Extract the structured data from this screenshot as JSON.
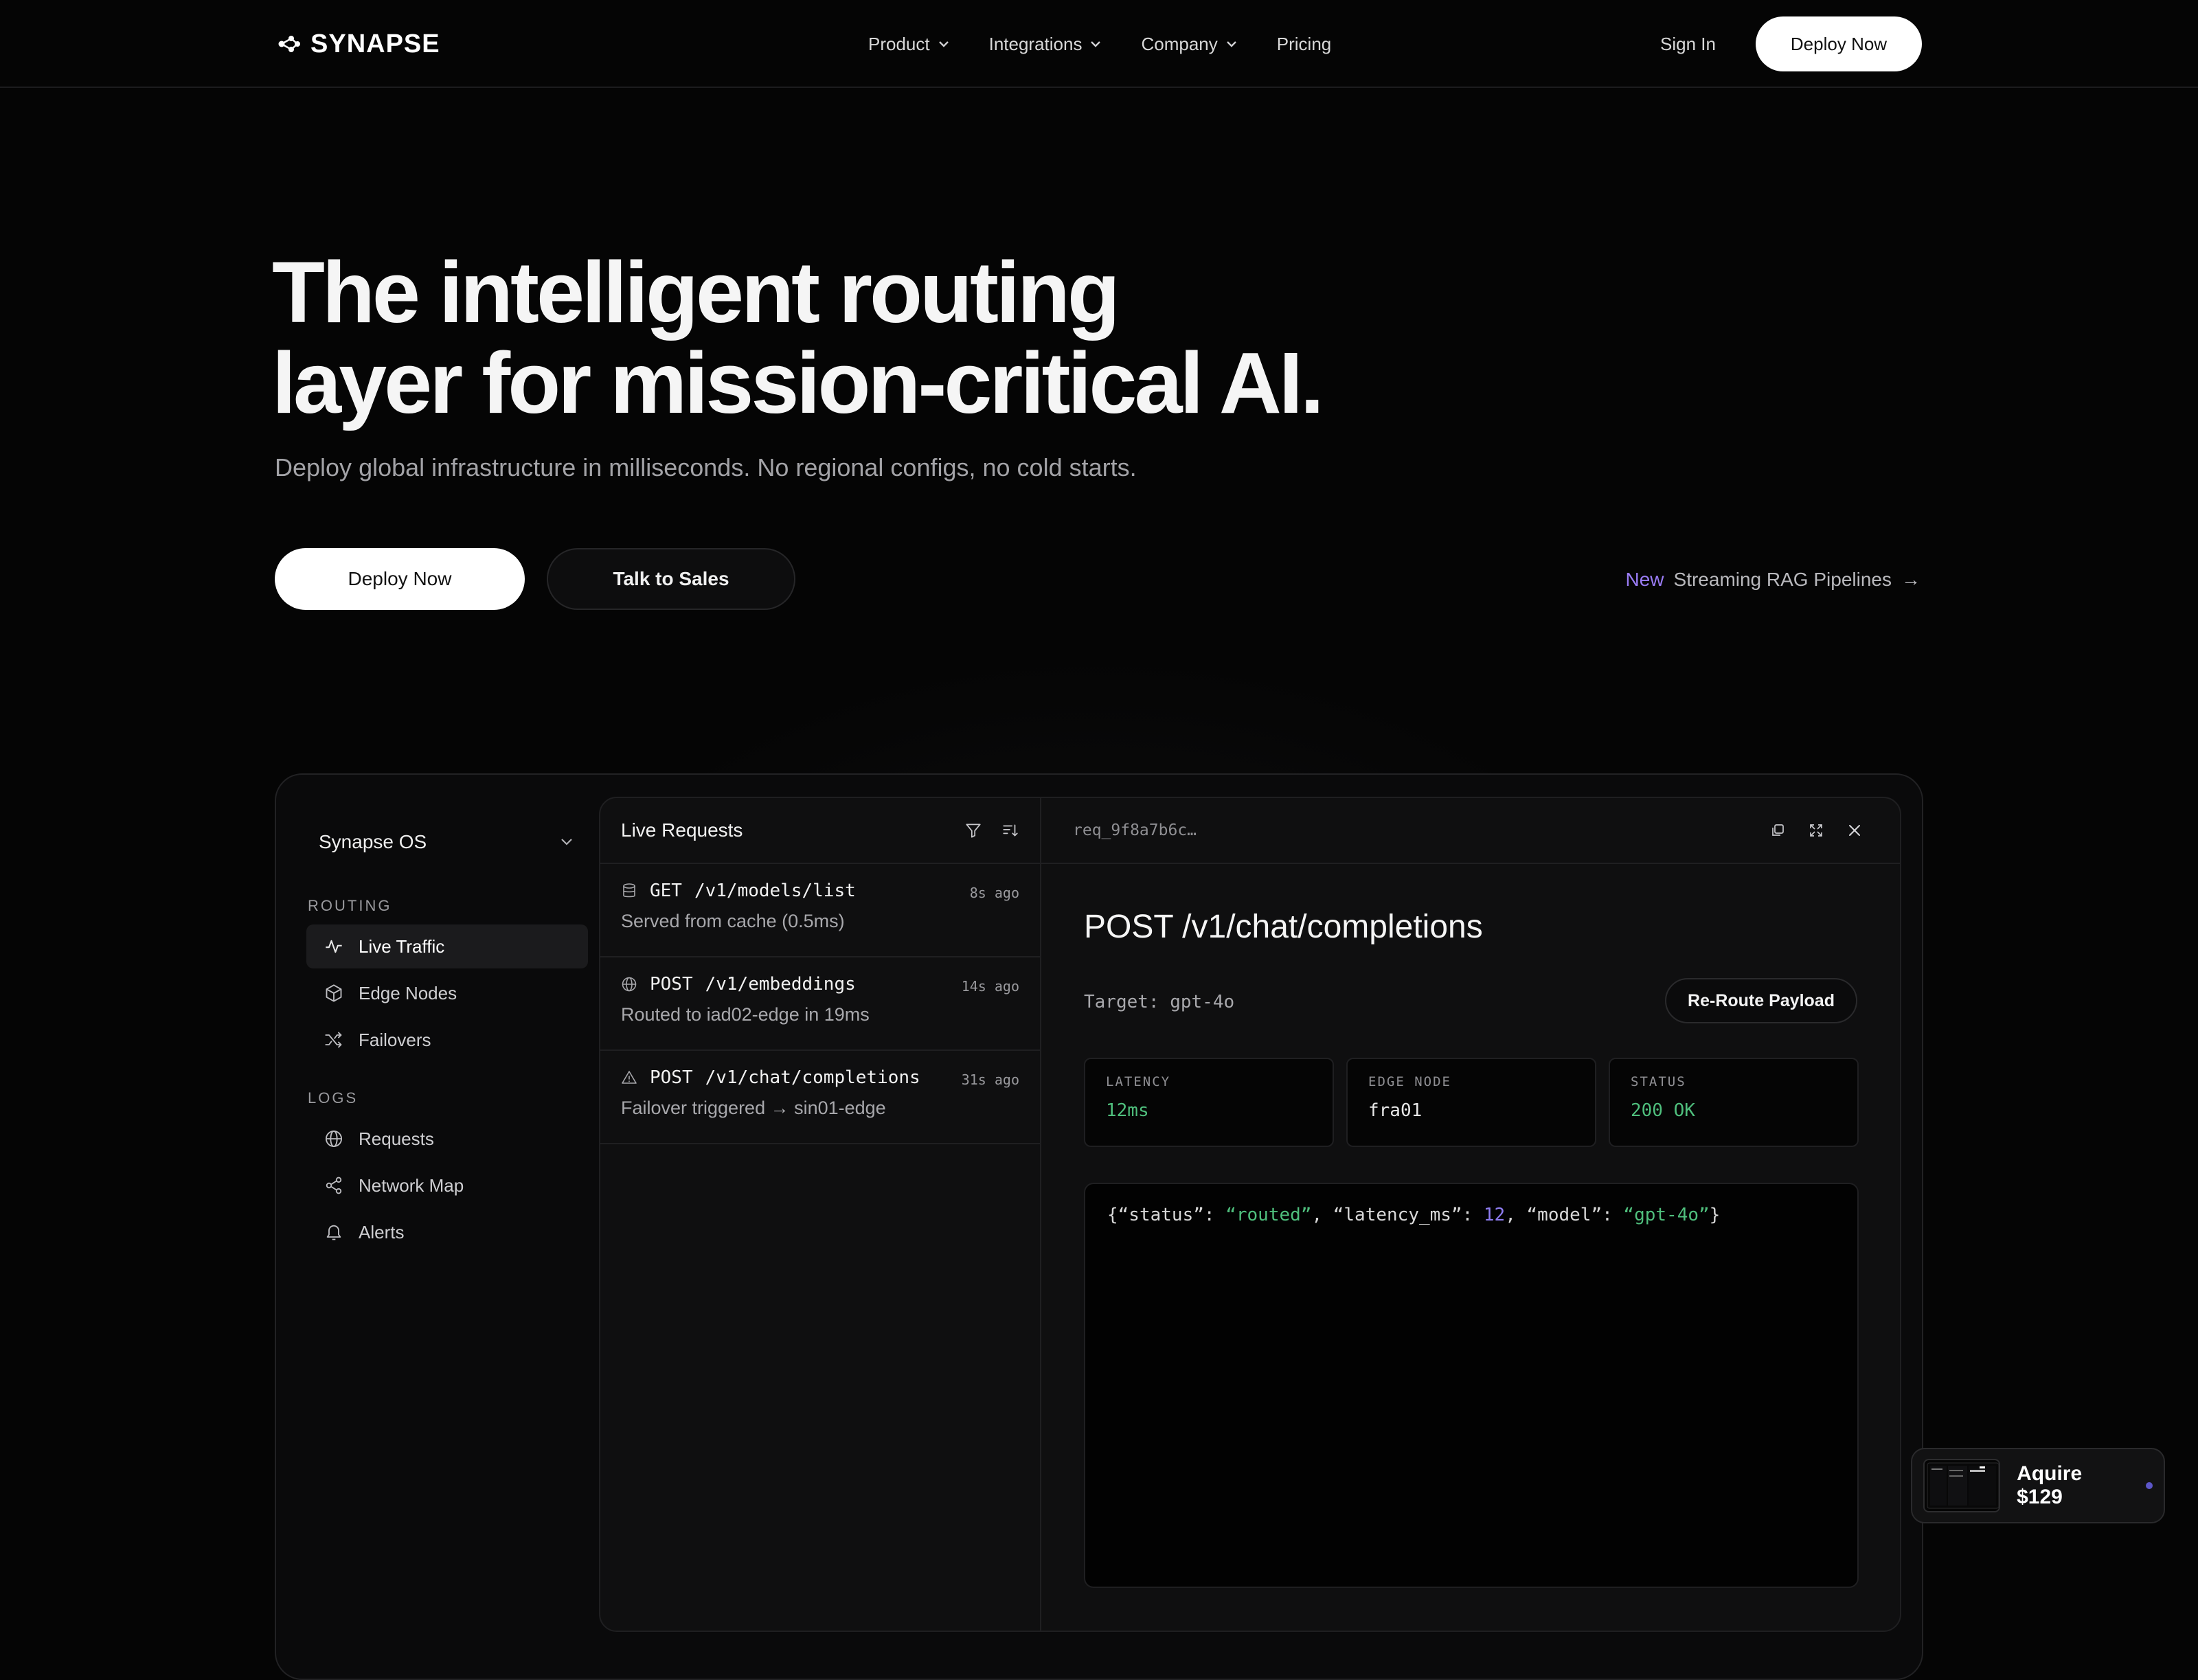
{
  "brand": {
    "name": "SYNAPSE"
  },
  "nav": {
    "links": [
      {
        "label": "Product",
        "has_dropdown": true
      },
      {
        "label": "Integrations",
        "has_dropdown": true
      },
      {
        "label": "Company",
        "has_dropdown": true
      },
      {
        "label": "Pricing",
        "has_dropdown": false
      }
    ],
    "sign_in": "Sign In",
    "cta": "Deploy Now"
  },
  "hero": {
    "title_line1": "The intelligent routing",
    "title_line2": "layer for mission-critical AI.",
    "subtitle": "Deploy global infrastructure in milliseconds. No regional configs, no cold starts.",
    "primary_cta": "Deploy Now",
    "secondary_cta": "Talk to Sales",
    "announcement": {
      "badge": "New",
      "text": "Streaming RAG Pipelines",
      "arrow": "→"
    }
  },
  "app": {
    "workspace": "Synapse OS",
    "sections": [
      {
        "label": "ROUTING",
        "items": [
          {
            "label": "Live Traffic",
            "icon": "activity-icon",
            "active": true
          },
          {
            "label": "Edge Nodes",
            "icon": "cube-icon",
            "active": false
          },
          {
            "label": "Failovers",
            "icon": "shuffle-icon",
            "active": false
          }
        ]
      },
      {
        "label": "LOGS",
        "items": [
          {
            "label": "Requests",
            "icon": "globe-icon",
            "active": false
          },
          {
            "label": "Network Map",
            "icon": "share-icon",
            "active": false
          },
          {
            "label": "Alerts",
            "icon": "bell-icon",
            "active": false
          }
        ]
      }
    ],
    "list": {
      "title": "Live Requests",
      "items": [
        {
          "method": "GET",
          "path": "/v1/models/list",
          "time": "8s ago",
          "detail": "Served from cache (0.5ms)",
          "icon": "database-icon"
        },
        {
          "method": "POST",
          "path": "/v1/embeddings",
          "time": "14s ago",
          "detail": "Routed to iad02-edge in 19ms",
          "icon": "globe-icon"
        },
        {
          "method": "POST",
          "path": "/v1/chat/completions",
          "time": "31s ago",
          "detail": "Failover triggered → sin01-edge",
          "icon": "warning-icon"
        }
      ]
    },
    "detail": {
      "request_id": "req_9f8a7b6c…",
      "title": "POST /v1/chat/completions",
      "target": "Target: gpt-4o",
      "reroute_label": "Re-Route Payload",
      "metrics": [
        {
          "label": "LATENCY",
          "value": "12ms",
          "color": "#4fbf7d"
        },
        {
          "label": "EDGE NODE",
          "value": "fra01",
          "color": "#ffffff"
        },
        {
          "label": "STATUS",
          "value": "200 OK",
          "color": "#4fbf7d"
        }
      ],
      "code": {
        "open": "{",
        "k1": "“status”",
        "v1": "“routed”",
        "k2": "“latency_ms”",
        "v2": "12",
        "k3": "“model”",
        "v3": "“gpt-4o”",
        "close": "}"
      }
    }
  },
  "purchase": {
    "label": "Aquire $129"
  },
  "colors": {
    "accent_purple": "#9a7cf5",
    "success_green": "#4fbf7d",
    "background": "#050505"
  }
}
